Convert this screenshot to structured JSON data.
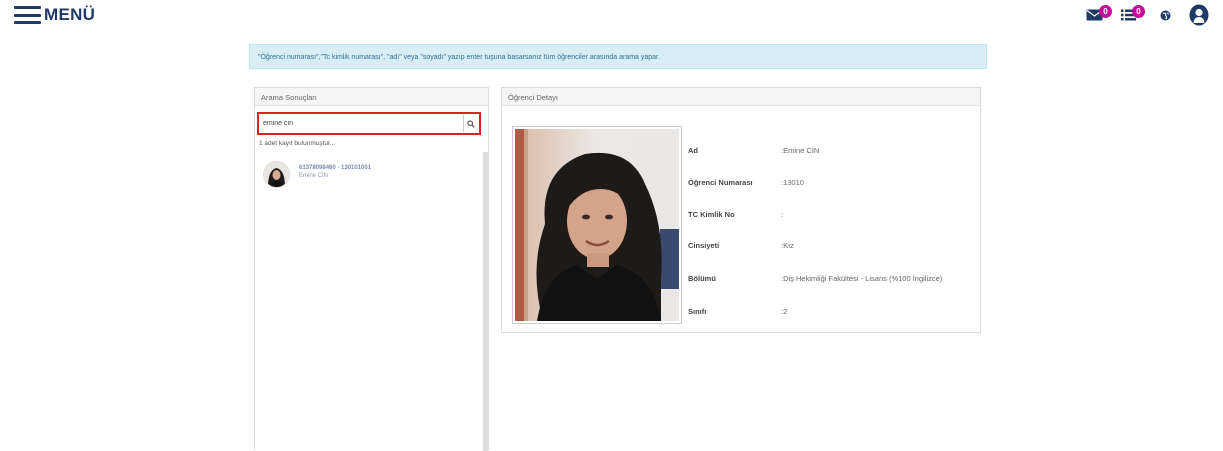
{
  "topbar": {
    "menu_label": "MENÜ",
    "messages_badge": "0",
    "tasks_badge": "0",
    "accent_color": "#1f3a66",
    "badge_color": "#c0109a",
    "icons": [
      "menu-hamburger-icon",
      "envelope-icon",
      "list-icon",
      "globe-icon",
      "user-icon"
    ]
  },
  "info": {
    "text": "\"Öğrenci numarası\",\"Tc kimlik numarası\", \"adı\" veya \"soyadı\" yazıp enter tuşuna basarsanız tüm öğrenciler arasında arama yapar."
  },
  "search": {
    "panel_title": "Arama Sonuçları",
    "query": "emine cin",
    "record_count": "1 adet kayıt bulunmuştur...",
    "results": [
      {
        "id_line": "61378098460 - 130101001",
        "name": "Emine CİN"
      }
    ]
  },
  "detail": {
    "panel_title": "Öğrenci Detayı",
    "rows": [
      {
        "label": "Ad",
        "value": ":Emine CİN"
      },
      {
        "label": "Öğrenci Numarası",
        "value": ":13010"
      },
      {
        "label": "TC Kimlik No",
        "value": ":"
      },
      {
        "label": "Cinsiyeti",
        "value": ":Kız"
      },
      {
        "label": "Bölümü",
        "value": ":Diş Hekimliği Fakültesi - Lisans (%100 İngilizce)"
      },
      {
        "label": "Sınıfı",
        "value": ":2"
      }
    ]
  }
}
